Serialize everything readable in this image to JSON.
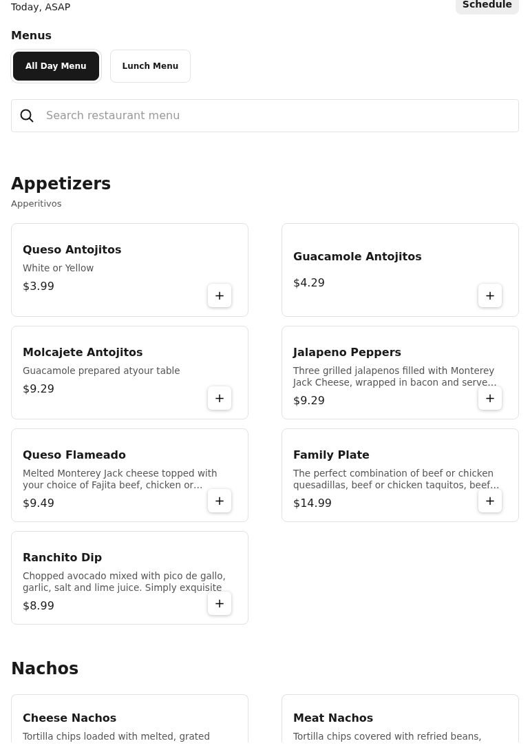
{
  "header": {
    "time": "Today, ASAP",
    "schedule_button": "Schedule"
  },
  "menus_title": "Menus",
  "menus": [
    {
      "label": "All Day Menu",
      "selected": true
    },
    {
      "label": "Lunch Menu",
      "selected": false
    }
  ],
  "search": {
    "placeholder": "Search restaurant menu"
  },
  "sections": [
    {
      "title": "Appetizers",
      "subtitle": "Apperitivos",
      "add_button": "+",
      "items": [
        {
          "name": "Queso Antojitos",
          "description": "White or Yellow",
          "price": "$3.99"
        },
        {
          "name": "Guacamole Antojitos",
          "price": "$4.29"
        },
        {
          "name": "Molcajete Antojitos",
          "description": "Guacamole prepared atyour table",
          "price": "$9.29"
        },
        {
          "name": "Jalapeno Peppers",
          "description": "Three grilled jalapenos filled with Monterey Jack Cheese, wrapped in bacon and serve…",
          "price": "$9.29"
        },
        {
          "name": "Queso Flameado",
          "description": "Melted Monterey Jack cheese topped with your choice of Fajita beef, chicken or…",
          "price": "$9.49"
        },
        {
          "name": "Family Plate",
          "description": "The perfect combination of beef or chicken quesadillas, beef or chicken taquitos, beef…",
          "price": "$14.99"
        },
        {
          "name": "Ranchito Dip",
          "description": "Chopped avocado mixed with pico de gallo, garlic, salt and lime juice. Simply exquisite",
          "price": "$8.99"
        }
      ]
    },
    {
      "title": "Nachos",
      "items": [
        {
          "name": "Cheese Nachos",
          "description": "Tortilla chips loaded with melted, grated"
        },
        {
          "name": "Meat Nachos",
          "description": "Tortilla chips covered with refried beans,"
        }
      ]
    }
  ]
}
